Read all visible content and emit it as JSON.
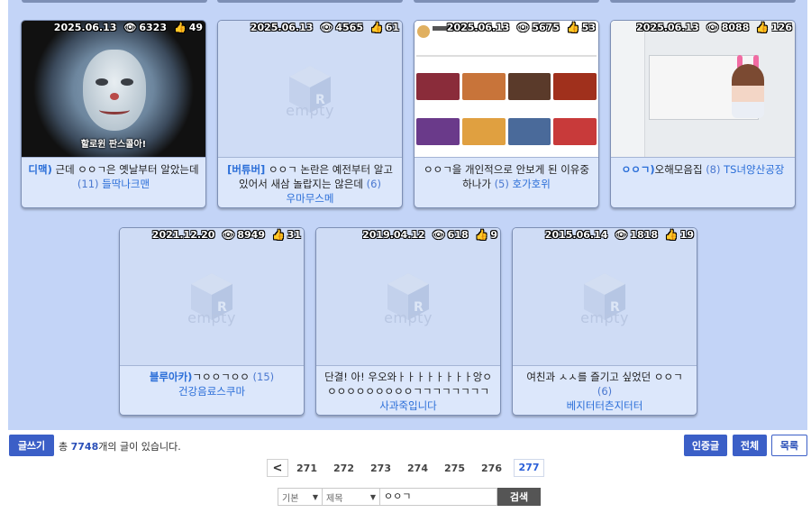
{
  "cards_row1": [
    {
      "date": "2025.06.13",
      "views": "6323",
      "likes": "49",
      "category": "디맥)",
      "title": " 근데 ㅇㅇㄱ은 옛날부터 알았는데",
      "count": "(11)",
      "author": "들딱나크맨",
      "thumb": "moon",
      "subtitle": "할로윈 판스콜아!"
    },
    {
      "date": "2025.06.13",
      "views": "4565",
      "likes": "61",
      "category": "[버튜버]",
      "title": " ㅇㅇㄱ 논란은 예전부터 알고 있어서 새삼 놀랍지는 않은데",
      "count": "(6)",
      "author": "우마무스메",
      "thumb": "empty"
    },
    {
      "date": "2025.06.13",
      "views": "5675",
      "likes": "53",
      "category": "",
      "title": "ㅇㅇㄱ을 개인적으로 안보게 된 이유중 하나가",
      "count": "(5)",
      "author": "호가호위",
      "thumb": "youtube"
    },
    {
      "date": "2025.06.13",
      "views": "8088",
      "likes": "126",
      "category": "ㅇㅇㄱ)",
      "title": "오해모음집",
      "count": "(8)",
      "author": "TS녀양산공장",
      "thumb": "vtuber"
    }
  ],
  "cards_row2": [
    {
      "date": "2021.12.20",
      "views": "8949",
      "likes": "31",
      "category": "블루아카)",
      "title": "ㄱㅇㅇㄱㅇㅇ",
      "count": "(15)",
      "author": "건강음료스쿠마",
      "thumb": "empty"
    },
    {
      "date": "2019.04.12",
      "views": "618",
      "likes": "9",
      "category": "",
      "title": "단결! 아! 우오와ㅏㅏㅏㅏㅏㅏㅏㅏ앙ㅇㅇㅇㅇㅇㅇㅇㅇㅇㅇㄱㄱㄱㄱㄱㄱㄱㄱ",
      "count": "",
      "author": "사과죽입니다",
      "thumb": "empty"
    },
    {
      "date": "2015.06.14",
      "views": "1818",
      "likes": "19",
      "category": "",
      "title": "여친과 ㅅㅅ를 즐기고 싶었던 ㅇㅇㄱ",
      "count": "(6)",
      "author": "베지터터츤지터터",
      "thumb": "empty"
    }
  ],
  "empty_label": "empty",
  "bottom": {
    "write": "글쓰기",
    "total_prefix": "총",
    "total_count": "7748",
    "total_suffix": "개의 글이 있습니다.",
    "btn_cert": "인증글",
    "btn_all": "전체",
    "btn_list": "목록"
  },
  "pager": {
    "prev": "<",
    "pages": [
      "271",
      "272",
      "273",
      "274",
      "275",
      "276"
    ],
    "current": "277"
  },
  "search": {
    "scope": "기본",
    "field": "제목",
    "query": "ㅇㅇㄱ",
    "button": "검색"
  },
  "colors": {
    "accent": "#3b5fc7",
    "panel": "#c3d4f7",
    "card": "#dce7fb"
  }
}
